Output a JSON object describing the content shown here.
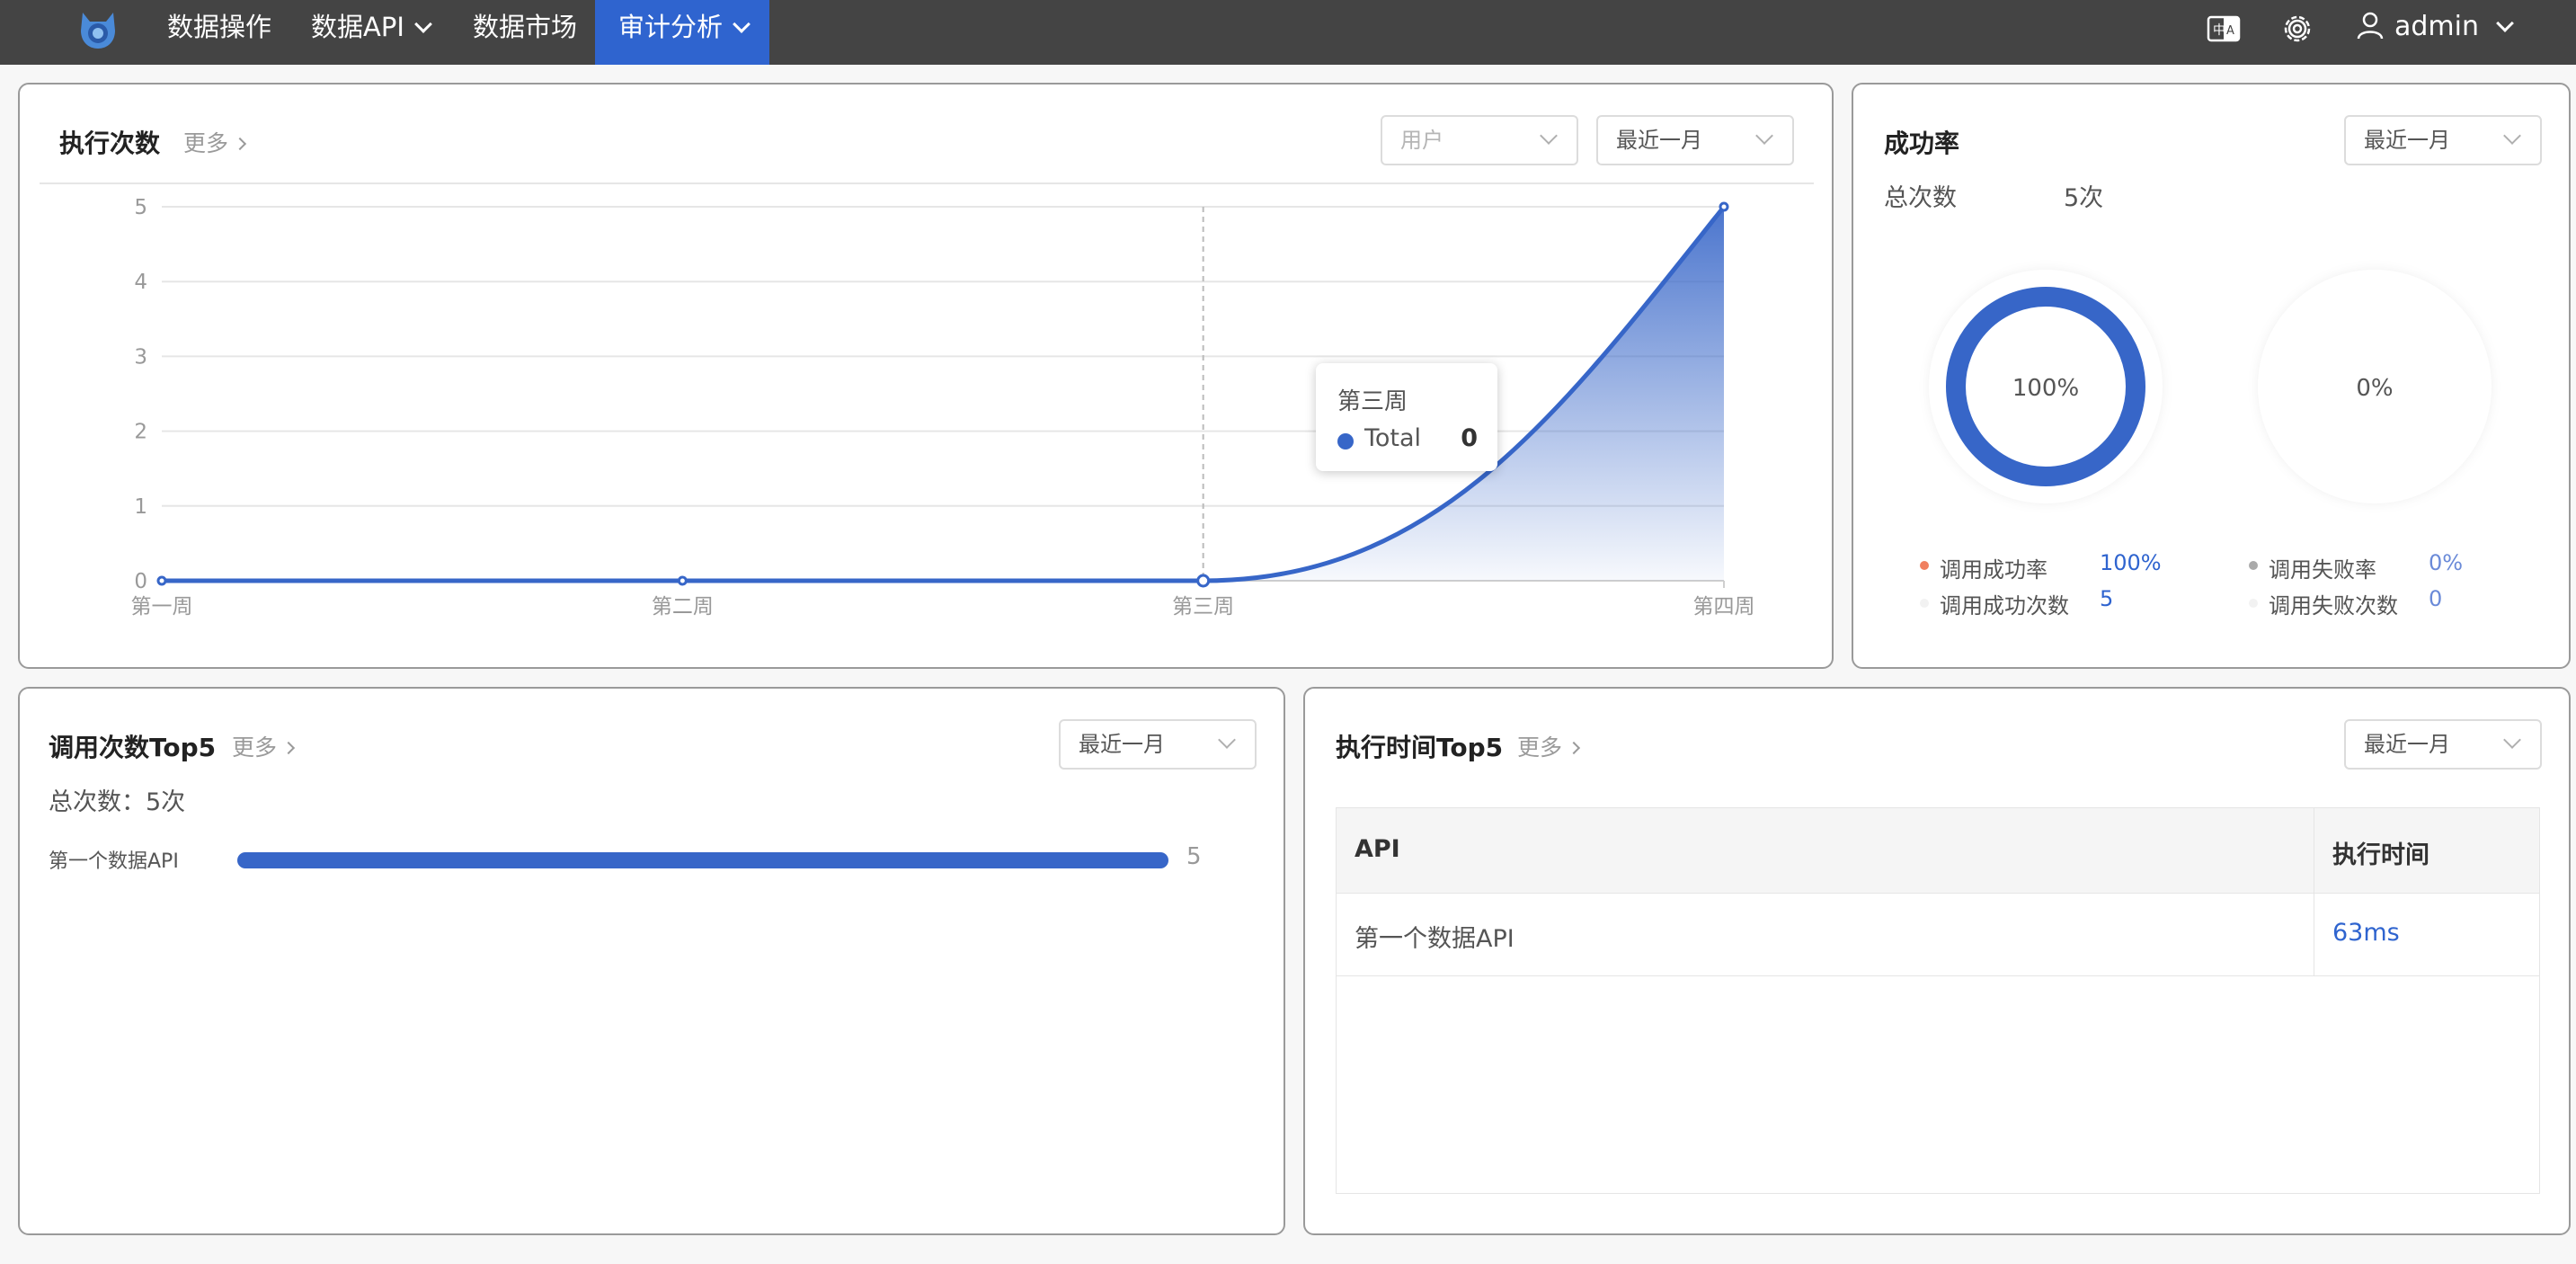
{
  "nav": {
    "items": [
      {
        "label": "数据操作",
        "has_dropdown": false,
        "active": false
      },
      {
        "label": "数据API",
        "has_dropdown": true,
        "active": false
      },
      {
        "label": "数据市场",
        "has_dropdown": false,
        "active": false
      },
      {
        "label": "审计分析",
        "has_dropdown": true,
        "active": true
      }
    ],
    "user_name": "admin",
    "icons": [
      "logo-icon",
      "translate-icon",
      "settings-icon",
      "user-icon",
      "chevron-down-icon"
    ],
    "active_color": "#2f64cf",
    "bar_color": "#444444"
  },
  "exec_count": {
    "title": "执行次数",
    "more": "更多",
    "user_select_placeholder": "用户",
    "period_select": "最近一月",
    "tooltip": {
      "title": "第三周",
      "series": "Total",
      "value": "0"
    },
    "ytick_labels": [
      "0",
      "1",
      "2",
      "3",
      "4",
      "5"
    ],
    "xtick_labels": [
      "第一周",
      "第二周",
      "第三周",
      "第四周"
    ]
  },
  "success_rate": {
    "title": "成功率",
    "period_select": "最近一月",
    "total_label": "总次数",
    "total_value": "5次",
    "success_pct_label": "100%",
    "fail_pct_label": "0%",
    "legend": {
      "success_rate_label": "调用成功率",
      "success_rate_value": "100%",
      "success_count_label": "调用成功次数",
      "success_count_value": "5",
      "fail_rate_label": "调用失败率",
      "fail_rate_value": "0%",
      "fail_count_label": "调用失败次数",
      "fail_count_value": "0"
    },
    "colors": {
      "success": "#3766c8",
      "success_dot": "#f08060",
      "fail_dot": "#aaaaaa",
      "value": "#2f64cf"
    }
  },
  "call_top5": {
    "title": "调用次数Top5",
    "more": "更多",
    "period_select": "最近一月",
    "total_text": "总次数：5次",
    "rows": [
      {
        "name": "第一个数据API",
        "count": "5",
        "fraction": 1.0
      }
    ]
  },
  "exec_time_top5": {
    "title": "执行时间Top5",
    "more": "更多",
    "period_select": "最近一月",
    "columns": [
      "API",
      "执行时间"
    ],
    "rows": [
      {
        "api": "第一个数据API",
        "time": "63ms"
      }
    ]
  },
  "chart_data": {
    "type": "area",
    "title": "执行次数",
    "categories": [
      "第一周",
      "第二周",
      "第三周",
      "第四周"
    ],
    "series": [
      {
        "name": "Total",
        "values": [
          0,
          0,
          0,
          5
        ]
      }
    ],
    "ylim": [
      0,
      5
    ],
    "grid": true,
    "highlighted_category": "第三周",
    "line_color": "#3766c8"
  }
}
